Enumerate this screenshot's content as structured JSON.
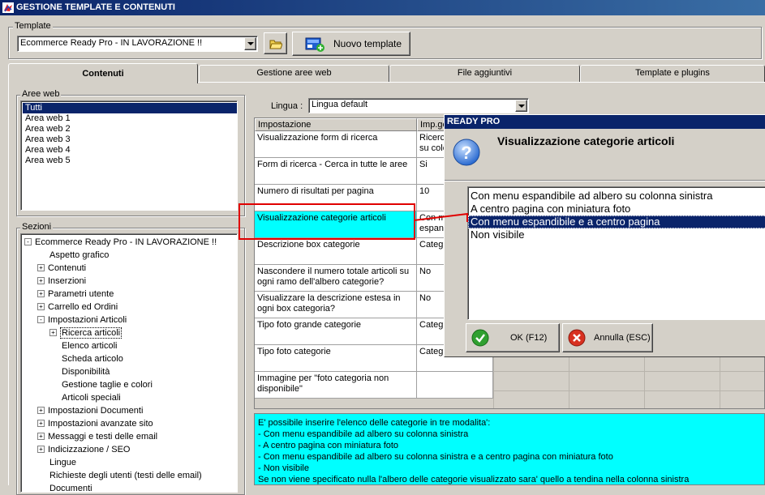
{
  "window": {
    "title": "GESTIONE TEMPLATE E CONTENUTI"
  },
  "template_group": {
    "label": "Template",
    "selected": "Ecommerce Ready Pro - IN LAVORAZIONE !!",
    "new_button": "Nuovo template"
  },
  "tabs": [
    {
      "label": "Contenuti",
      "active": true
    },
    {
      "label": "Gestione aree web",
      "active": false
    },
    {
      "label": "File aggiuntivi",
      "active": false
    },
    {
      "label": "Template e plugins",
      "active": false
    }
  ],
  "aree_web": {
    "label": "Aree web",
    "items": [
      "Tutti",
      "Area web 1",
      "Area web 2",
      "Area web 3",
      "Area web 4",
      "Area web 5"
    ],
    "selected_index": 0
  },
  "sezioni": {
    "label": "Sezioni",
    "tree": [
      {
        "label": "Ecommerce Ready Pro - IN LAVORAZIONE !!",
        "level": 0,
        "exp": "-"
      },
      {
        "label": "Aspetto grafico",
        "level": 1,
        "exp": ""
      },
      {
        "label": "Contenuti",
        "level": 1,
        "exp": "+"
      },
      {
        "label": "Inserzioni",
        "level": 1,
        "exp": "+"
      },
      {
        "label": "Parametri utente",
        "level": 1,
        "exp": "+"
      },
      {
        "label": "Carrello ed Ordini",
        "level": 1,
        "exp": "+"
      },
      {
        "label": "Impostazioni Articoli",
        "level": 1,
        "exp": "-"
      },
      {
        "label": "Ricerca articoli",
        "level": 2,
        "exp": "+",
        "selected": true
      },
      {
        "label": "Elenco articoli",
        "level": 2,
        "exp": ""
      },
      {
        "label": "Scheda articolo",
        "level": 2,
        "exp": ""
      },
      {
        "label": "Disponibilità",
        "level": 2,
        "exp": ""
      },
      {
        "label": "Gestione taglie e colori",
        "level": 2,
        "exp": ""
      },
      {
        "label": "Articoli speciali",
        "level": 2,
        "exp": ""
      },
      {
        "label": "Impostazioni Documenti",
        "level": 1,
        "exp": "+"
      },
      {
        "label": "Impostazioni avanzate sito",
        "level": 1,
        "exp": "+"
      },
      {
        "label": "Messaggi e testi delle email",
        "level": 1,
        "exp": "+"
      },
      {
        "label": "Indicizzazione / SEO",
        "level": 1,
        "exp": "+"
      },
      {
        "label": "Lingue",
        "level": 1,
        "exp": ""
      },
      {
        "label": "Richieste degli utenti (testi delle email)",
        "level": 1,
        "exp": ""
      },
      {
        "label": "Documenti",
        "level": 1,
        "exp": ""
      }
    ]
  },
  "lingua": {
    "label": "Lingua :",
    "selected": "Lingua default"
  },
  "grid": {
    "headers": [
      "Impostazione",
      "Imp.ge"
    ],
    "rows": [
      {
        "name": "Visualizzazione form di ricerca",
        "value": "Ricerc\nsu colo"
      },
      {
        "name": "Form di ricerca - Cerca in tutte le aree",
        "value": "Si"
      },
      {
        "name": "Numero di risultati per pagina",
        "value": "10"
      },
      {
        "name": "Visualizzazione categorie articoli",
        "value": "Con m\nespan",
        "highlight": true
      },
      {
        "name": "Descrizione box categorie",
        "value": "Categ"
      },
      {
        "name": "Nascondere il numero totale articoli su ogni ramo dell'albero categorie?",
        "value": "No"
      },
      {
        "name": "Visualizzare la descrizione estesa in ogni box categoria?",
        "value": "No"
      },
      {
        "name": "Tipo foto grande categorie",
        "value": "Categ"
      },
      {
        "name": "Tipo foto categorie",
        "value": "Categ"
      },
      {
        "name": "Immagine per \"foto categoria non disponibile\"",
        "value": ""
      }
    ]
  },
  "dialog": {
    "app_title": "READY PRO",
    "heading": "Visualizzazione categorie articoli",
    "options": [
      "Con menu espandibile ad albero su colonna sinistra",
      "A centro pagina con miniatura foto",
      "Con menu espandibile e a centro pagina",
      "Non visibile"
    ],
    "selected_index": 2,
    "ok_label": "OK (F12)",
    "cancel_label": "Annulla (ESC)"
  },
  "info": {
    "lines": [
      "E' possibile inserire l'elenco delle categorie in tre modalita':",
      "- Con menu espandibile ad albero su colonna sinistra",
      "- A centro pagina con miniatura foto",
      "- Con menu espandibile ad albero su colonna sinistra e a centro pagina con miniatura foto",
      "- Non visibile",
      "Se non viene specificato nulla l'albero delle categorie visualizzato sara' quello a tendina nella colonna sinistra"
    ]
  },
  "colors": {
    "titlebar": "#0a246a",
    "highlight_cell": "#00ffff",
    "annotation": "#e00000",
    "selection": "#0a246a"
  }
}
